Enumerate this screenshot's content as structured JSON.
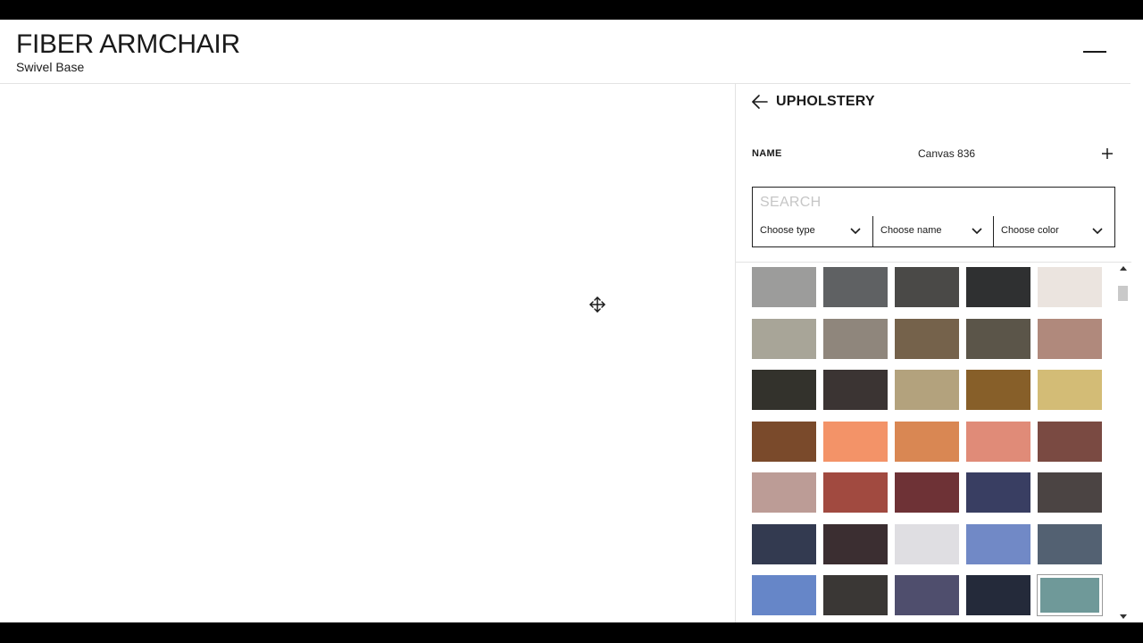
{
  "header": {
    "title": "FIBER ARMCHAIR",
    "subtitle": "Swivel Base",
    "menu_icon": "hamburger-menu-icon"
  },
  "canvas": {
    "move_icon": "move-arrows-icon"
  },
  "panel": {
    "back_icon": "arrow-left-icon",
    "section_title": "UPHOLSTERY",
    "name_label": "NAME",
    "name_value": "Canvas 836",
    "add_icon": "plus-icon",
    "search": {
      "placeholder": "SEARCH",
      "value": ""
    },
    "filters": [
      {
        "label": "Choose type"
      },
      {
        "label": "Choose name"
      },
      {
        "label": "Choose color"
      }
    ],
    "swatches": [
      [
        "#9c9c9b",
        "#5f6163",
        "#4a4947",
        "#2f3031",
        "#ebe4df"
      ],
      [
        "#a8a598",
        "#8f867c",
        "#75624b",
        "#5b5549",
        "#b0897c"
      ],
      [
        "#33322c",
        "#3b3433",
        "#b3a27d",
        "#875f29",
        "#d3bc76"
      ],
      [
        "#7a4a2b",
        "#f39368",
        "#d98753",
        "#e08b78",
        "#7a4a42"
      ],
      [
        "#bc9c96",
        "#a14a40",
        "#6e3236",
        "#393e62",
        "#4b4443"
      ],
      [
        "#333a50",
        "#3b2e31",
        "#dfdee2",
        "#7189c6",
        "#536172"
      ],
      [
        "#6686c8",
        "#3a3735",
        "#4f4e6d",
        "#242a3a",
        "#6f9999"
      ]
    ],
    "selected_swatch": "#6f9999"
  },
  "colors": {
    "accent": "#1a1a1a",
    "border": "#e3e3e3",
    "placeholder": "#c6c6c6"
  }
}
